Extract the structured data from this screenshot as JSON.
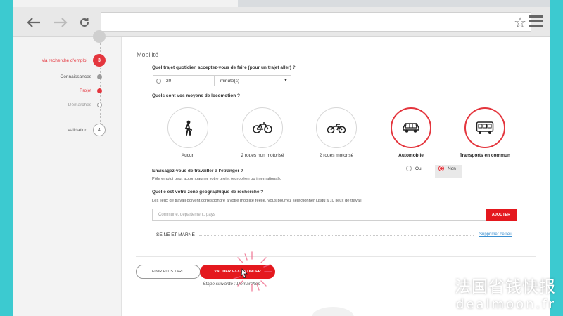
{
  "sidebar": {
    "steps": [
      {
        "label": "Ma recherche d'emploi",
        "badge": "3",
        "state": "active-parent"
      },
      {
        "label": "Connaissances",
        "badge": "",
        "state": "done"
      },
      {
        "label": "Projet",
        "badge": "",
        "state": "current"
      },
      {
        "label": "Démarches",
        "badge": "",
        "state": "todo"
      },
      {
        "label": "Validation",
        "badge": "4",
        "state": "future"
      }
    ]
  },
  "section": {
    "title": "Mobilité"
  },
  "commute": {
    "question": "Quel trajet quotidien acceptez-vous de faire (pour un trajet aller) ?",
    "value": "20",
    "unit": "minute(s)"
  },
  "transport": {
    "question": "Quels sont vos moyens de locomotion ?",
    "options": [
      {
        "label": "Aucun",
        "icon": "walking-person-icon",
        "selected": false
      },
      {
        "label": "2 roues non motorisé",
        "icon": "bicycle-icon",
        "selected": false
      },
      {
        "label": "2 roues motorisé",
        "icon": "motorbike-icon",
        "selected": false
      },
      {
        "label": "Automobile",
        "icon": "car-icon",
        "selected": true
      },
      {
        "label": "Transports en commun",
        "icon": "bus-icon",
        "selected": true
      }
    ]
  },
  "abroad": {
    "question": "Envisagez-vous de travailler à l'étranger ?",
    "help": "Pôle emploi peut accompagner votre projet (européen ou international).",
    "yes_label": "Oui",
    "no_label": "Non",
    "selected": "Non"
  },
  "zone": {
    "question": "Quelle est votre zone géographique de recherche ?",
    "help": "Les lieux de travail doivent correspondre à votre mobilité réelle. Vous pourrez sélectionner jusqu'à 10 lieux de travail.",
    "placeholder": "Commune, département, pays",
    "add_label": "AJOUTER",
    "items": [
      {
        "name": "SEINE ET MARNE",
        "remove_label": "Supprimer ce lieu"
      }
    ]
  },
  "actions": {
    "later_label": "FINIR PLUS TARD",
    "validate_label": "VALIDER ET CONTINUER",
    "next_step": "Étape suivante : Démarches"
  },
  "watermark": {
    "cn": "法国省钱快报",
    "en": "dealmoon.fr"
  },
  "colors": {
    "accent": "#e4181e",
    "teal": "#3ccad0"
  }
}
